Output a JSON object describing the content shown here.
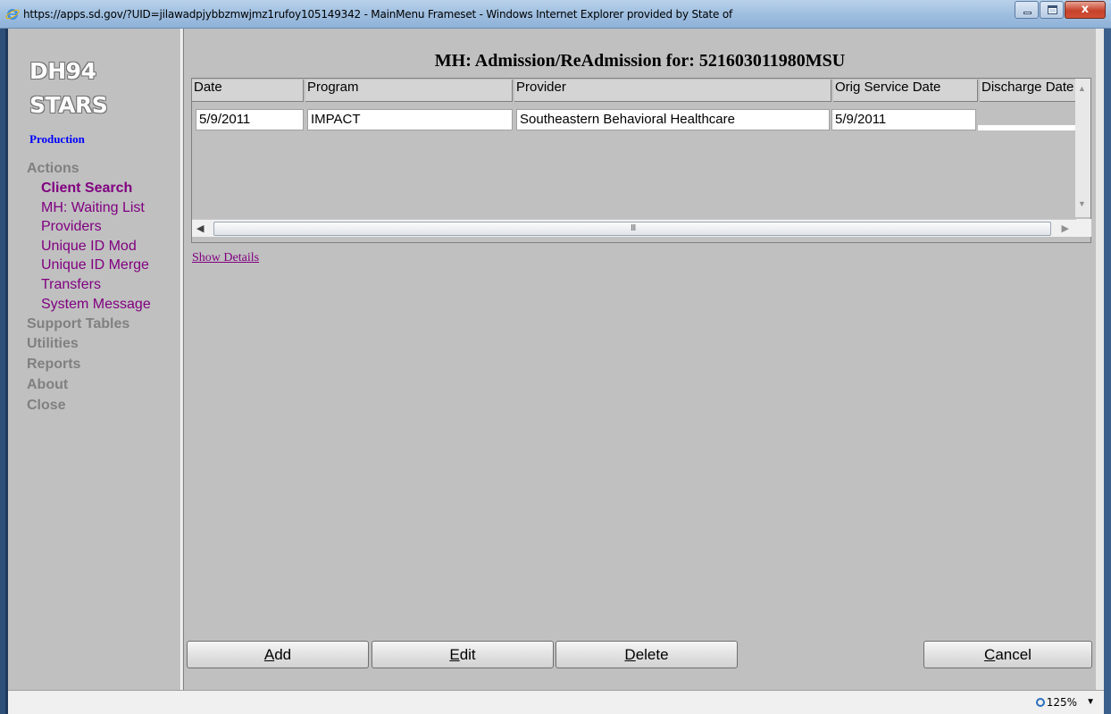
{
  "window": {
    "title": "https://apps.sd.gov/?UID=jilawadpjybbzmwjmz1rufoy105149342 - MainMenu Frameset - Windows Internet Explorer provided by State of",
    "close_glyph": "x"
  },
  "sidebar": {
    "logo_line1": "DH94",
    "logo_line2": "STARS",
    "environment": "Production",
    "sections": [
      {
        "label": "Actions"
      },
      {
        "label": "Support Tables"
      },
      {
        "label": "Utilities"
      },
      {
        "label": "Reports"
      },
      {
        "label": "About"
      },
      {
        "label": "Close"
      }
    ],
    "action_items": [
      {
        "label": "Client Search",
        "active": true
      },
      {
        "label": "MH: Waiting List"
      },
      {
        "label": "Providers"
      },
      {
        "label": "Unique ID Mod"
      },
      {
        "label": "Unique ID Merge"
      },
      {
        "label": "Transfers"
      },
      {
        "label": "System Message"
      }
    ]
  },
  "main": {
    "heading": "MH: Admission/ReAdmission for: 521603011980MSU",
    "table": {
      "columns": [
        "Date",
        "Program",
        "Provider",
        "Orig Service Date",
        "Discharge Date"
      ],
      "rows": [
        [
          "5/9/2011",
          "IMPACT",
          "Southeastern Behavioral Healthcare",
          "5/9/2011",
          ""
        ]
      ]
    },
    "scroll_grip": "III",
    "show_details": "Show Details",
    "buttons": {
      "add": {
        "accel": "A",
        "rest": "dd"
      },
      "edit": {
        "accel": "E",
        "rest": "dit"
      },
      "delete": {
        "accel": "D",
        "rest": "elete"
      },
      "cancel": {
        "accel": "C",
        "rest": "ancel"
      }
    }
  },
  "status": {
    "zoom": "125%"
  },
  "colors": {
    "link_visited": "#800080",
    "environment": "#0000ff",
    "background": "#c0c0c0"
  },
  "icons": [
    "ie-logo-icon",
    "minimize-icon",
    "maximize-icon",
    "close-icon",
    "zoom-icon",
    "dropdown-arrow-icon"
  ]
}
